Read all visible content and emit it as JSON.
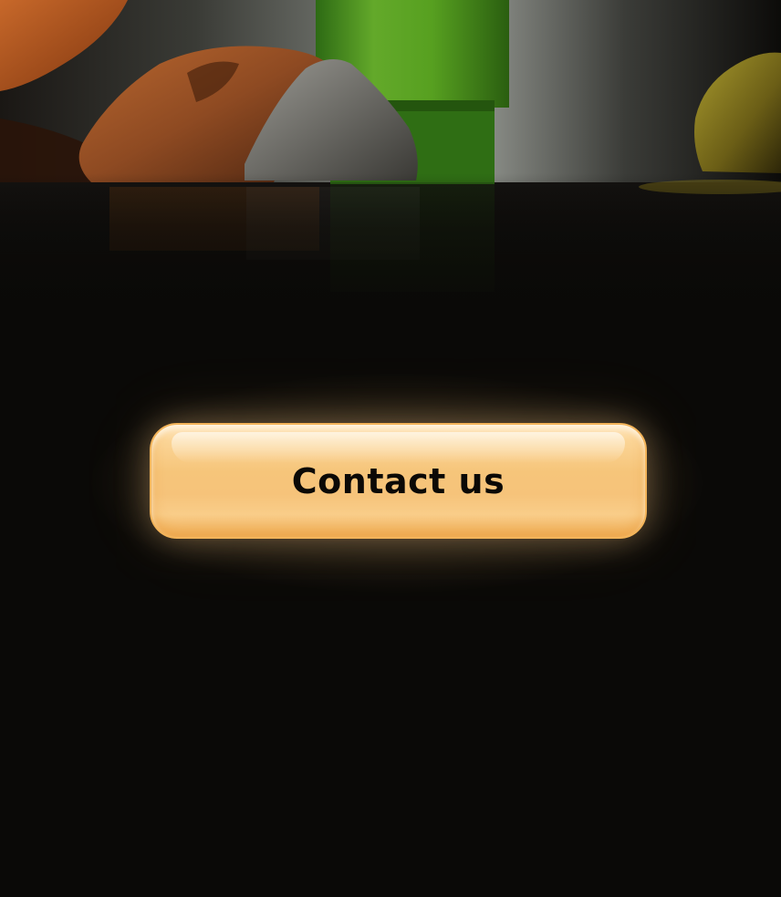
{
  "page": {
    "background_color": "#0a0907"
  },
  "hero": {
    "image_icon": "rocks-and-green-bottle-illustration-icon"
  },
  "cta": {
    "label": "Contact us",
    "color": "#f6c57a",
    "border_color": "#f3b45a",
    "text_color": "#0b0906"
  }
}
